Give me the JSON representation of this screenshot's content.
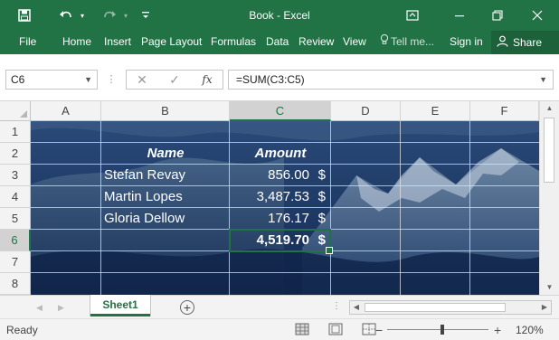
{
  "titlebar": {
    "title": "Book - Excel",
    "icons": [
      "save-icon",
      "undo-icon",
      "redo-icon",
      "customize-qat-icon",
      "ribbon-display-options-icon",
      "minimize-icon",
      "restore-icon",
      "close-icon"
    ]
  },
  "ribbon": {
    "tabs": [
      "File",
      "Home",
      "Insert",
      "Page Layout",
      "Formulas",
      "Data",
      "Review",
      "View"
    ],
    "tell_me": "Tell me...",
    "sign_in": "Sign in",
    "share": "Share"
  },
  "formula_bar": {
    "name_box": "C6",
    "formula": "=SUM(C3:C5)",
    "cancel_icon": "✕",
    "enter_icon": "✓",
    "fx_label": "fx"
  },
  "sheet": {
    "columns": [
      "A",
      "B",
      "C",
      "D",
      "E",
      "F"
    ],
    "rows": [
      "1",
      "2",
      "3",
      "4",
      "5",
      "6",
      "7",
      "8"
    ],
    "selected_cell": "C6",
    "header_name": "Name",
    "header_amount": "Amount",
    "data_rows": [
      {
        "name": "Stefan Revay",
        "amount": "856.00",
        "currency": "$"
      },
      {
        "name": "Martin Lopes",
        "amount": "3,487.53",
        "currency": "$"
      },
      {
        "name": "Gloria Dellow",
        "amount": "176.17",
        "currency": "$"
      }
    ],
    "total": {
      "amount": "4,519.70",
      "currency": "$"
    }
  },
  "sheet_tabs": {
    "active": "Sheet1",
    "add_icon": "+"
  },
  "status": {
    "ready": "Ready",
    "zoom": "120%",
    "zoom_fraction": 0.54
  },
  "colors": {
    "accent": "#217346",
    "cell_text": "#ffffff"
  }
}
